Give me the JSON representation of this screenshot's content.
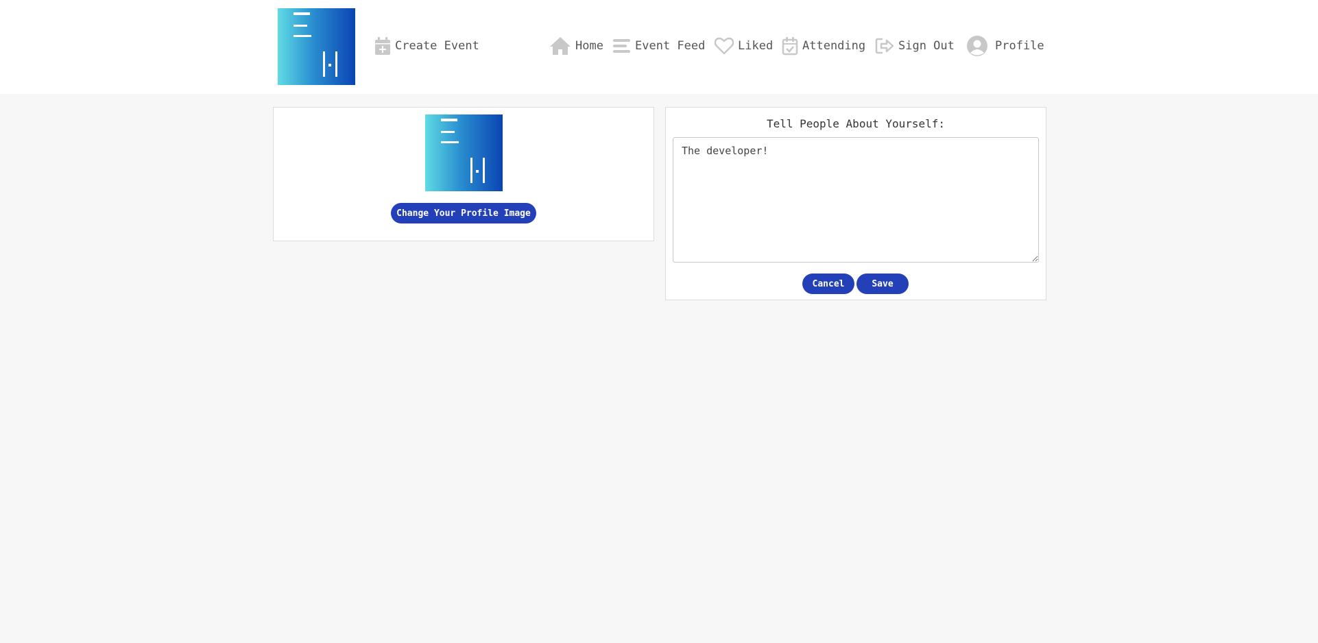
{
  "header": {
    "create_event": "Create Event",
    "nav": {
      "home": "Home",
      "event_feed": "Event Feed",
      "liked": "Liked",
      "attending": "Attending",
      "sign_out": "Sign Out",
      "profile": "Profile"
    }
  },
  "profile_image": {
    "change_button": "Change Your Profile Image"
  },
  "about": {
    "label": "Tell People About Yourself:",
    "text": "The developer!",
    "cancel": "Cancel",
    "save": "Save"
  },
  "colors": {
    "accent": "#2340b8",
    "icon": "#c8c8c8",
    "logo_gradient_start": "#5fdbe4",
    "logo_gradient_end": "#0a44b3"
  }
}
